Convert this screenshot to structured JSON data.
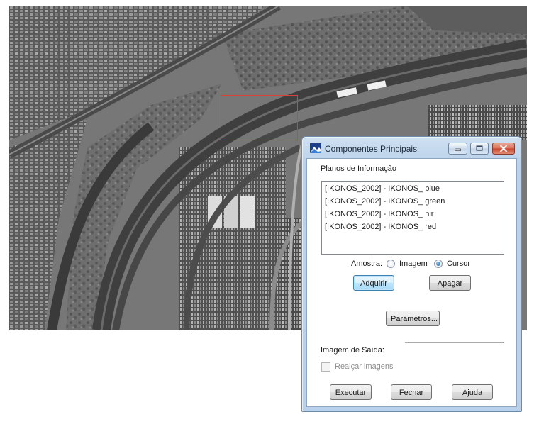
{
  "dialog": {
    "title": "Componentes Principais",
    "planes_label": "Planos de Informação",
    "planes": [
      "[IKONOS_2002] - IKONOS_ blue",
      "[IKONOS_2002] - IKONOS_ green",
      "[IKONOS_2002] - IKONOS_ nir",
      "[IKONOS_2002] - IKONOS_ red"
    ],
    "sample": {
      "label": "Amostra:",
      "options": [
        "Imagem",
        "Cursor"
      ],
      "selected": "Cursor"
    },
    "buttons": {
      "adquirir": "Adquirir",
      "apagar": "Apagar",
      "parametros": "Parâmetros...",
      "executar": "Executar",
      "fechar": "Fechar",
      "ajuda": "Ajuda"
    },
    "output_label": "Imagem de Saída:",
    "enhance_label": "Realçar imagens",
    "enhance_checked": false,
    "enhance_enabled": false
  },
  "icons": {
    "app": "spring-app-icon",
    "minimize": "minimize-icon",
    "maximize": "maximize-icon",
    "close": "close-icon"
  },
  "colors": {
    "selection_box": "#d9413a",
    "title_bar": "#b9d1ea",
    "close_button": "#c8442b"
  }
}
